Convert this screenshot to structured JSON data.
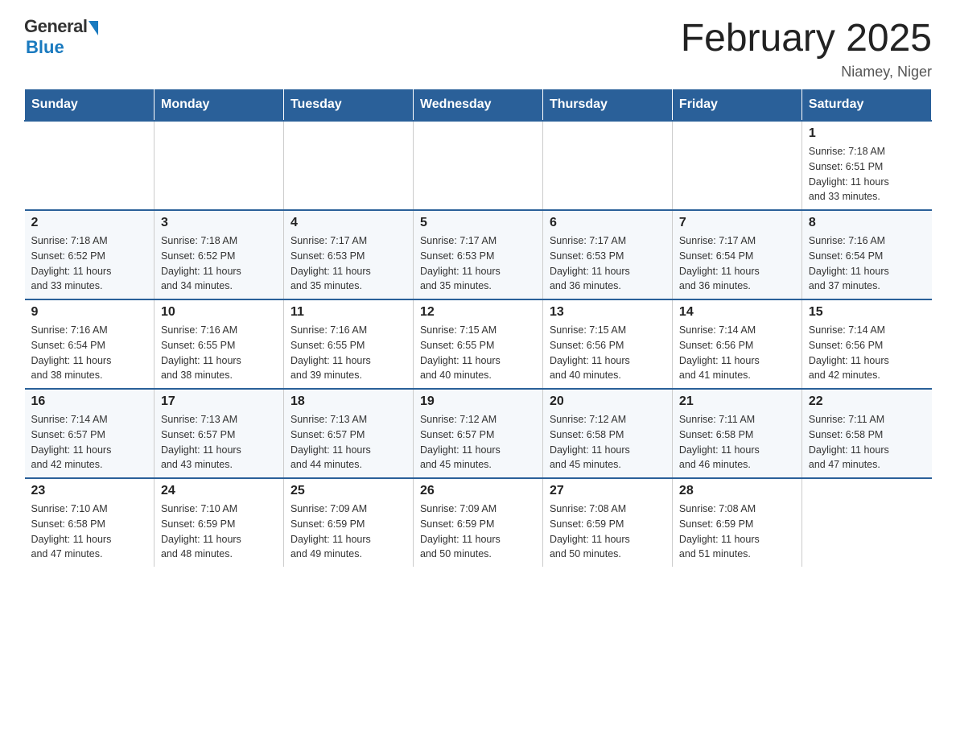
{
  "header": {
    "logo_general": "General",
    "logo_blue": "Blue",
    "title": "February 2025",
    "location": "Niamey, Niger"
  },
  "days_of_week": [
    "Sunday",
    "Monday",
    "Tuesday",
    "Wednesday",
    "Thursday",
    "Friday",
    "Saturday"
  ],
  "weeks": [
    [
      {
        "day": "",
        "info": ""
      },
      {
        "day": "",
        "info": ""
      },
      {
        "day": "",
        "info": ""
      },
      {
        "day": "",
        "info": ""
      },
      {
        "day": "",
        "info": ""
      },
      {
        "day": "",
        "info": ""
      },
      {
        "day": "1",
        "info": "Sunrise: 7:18 AM\nSunset: 6:51 PM\nDaylight: 11 hours\nand 33 minutes."
      }
    ],
    [
      {
        "day": "2",
        "info": "Sunrise: 7:18 AM\nSunset: 6:52 PM\nDaylight: 11 hours\nand 33 minutes."
      },
      {
        "day": "3",
        "info": "Sunrise: 7:18 AM\nSunset: 6:52 PM\nDaylight: 11 hours\nand 34 minutes."
      },
      {
        "day": "4",
        "info": "Sunrise: 7:17 AM\nSunset: 6:53 PM\nDaylight: 11 hours\nand 35 minutes."
      },
      {
        "day": "5",
        "info": "Sunrise: 7:17 AM\nSunset: 6:53 PM\nDaylight: 11 hours\nand 35 minutes."
      },
      {
        "day": "6",
        "info": "Sunrise: 7:17 AM\nSunset: 6:53 PM\nDaylight: 11 hours\nand 36 minutes."
      },
      {
        "day": "7",
        "info": "Sunrise: 7:17 AM\nSunset: 6:54 PM\nDaylight: 11 hours\nand 36 minutes."
      },
      {
        "day": "8",
        "info": "Sunrise: 7:16 AM\nSunset: 6:54 PM\nDaylight: 11 hours\nand 37 minutes."
      }
    ],
    [
      {
        "day": "9",
        "info": "Sunrise: 7:16 AM\nSunset: 6:54 PM\nDaylight: 11 hours\nand 38 minutes."
      },
      {
        "day": "10",
        "info": "Sunrise: 7:16 AM\nSunset: 6:55 PM\nDaylight: 11 hours\nand 38 minutes."
      },
      {
        "day": "11",
        "info": "Sunrise: 7:16 AM\nSunset: 6:55 PM\nDaylight: 11 hours\nand 39 minutes."
      },
      {
        "day": "12",
        "info": "Sunrise: 7:15 AM\nSunset: 6:55 PM\nDaylight: 11 hours\nand 40 minutes."
      },
      {
        "day": "13",
        "info": "Sunrise: 7:15 AM\nSunset: 6:56 PM\nDaylight: 11 hours\nand 40 minutes."
      },
      {
        "day": "14",
        "info": "Sunrise: 7:14 AM\nSunset: 6:56 PM\nDaylight: 11 hours\nand 41 minutes."
      },
      {
        "day": "15",
        "info": "Sunrise: 7:14 AM\nSunset: 6:56 PM\nDaylight: 11 hours\nand 42 minutes."
      }
    ],
    [
      {
        "day": "16",
        "info": "Sunrise: 7:14 AM\nSunset: 6:57 PM\nDaylight: 11 hours\nand 42 minutes."
      },
      {
        "day": "17",
        "info": "Sunrise: 7:13 AM\nSunset: 6:57 PM\nDaylight: 11 hours\nand 43 minutes."
      },
      {
        "day": "18",
        "info": "Sunrise: 7:13 AM\nSunset: 6:57 PM\nDaylight: 11 hours\nand 44 minutes."
      },
      {
        "day": "19",
        "info": "Sunrise: 7:12 AM\nSunset: 6:57 PM\nDaylight: 11 hours\nand 45 minutes."
      },
      {
        "day": "20",
        "info": "Sunrise: 7:12 AM\nSunset: 6:58 PM\nDaylight: 11 hours\nand 45 minutes."
      },
      {
        "day": "21",
        "info": "Sunrise: 7:11 AM\nSunset: 6:58 PM\nDaylight: 11 hours\nand 46 minutes."
      },
      {
        "day": "22",
        "info": "Sunrise: 7:11 AM\nSunset: 6:58 PM\nDaylight: 11 hours\nand 47 minutes."
      }
    ],
    [
      {
        "day": "23",
        "info": "Sunrise: 7:10 AM\nSunset: 6:58 PM\nDaylight: 11 hours\nand 47 minutes."
      },
      {
        "day": "24",
        "info": "Sunrise: 7:10 AM\nSunset: 6:59 PM\nDaylight: 11 hours\nand 48 minutes."
      },
      {
        "day": "25",
        "info": "Sunrise: 7:09 AM\nSunset: 6:59 PM\nDaylight: 11 hours\nand 49 minutes."
      },
      {
        "day": "26",
        "info": "Sunrise: 7:09 AM\nSunset: 6:59 PM\nDaylight: 11 hours\nand 50 minutes."
      },
      {
        "day": "27",
        "info": "Sunrise: 7:08 AM\nSunset: 6:59 PM\nDaylight: 11 hours\nand 50 minutes."
      },
      {
        "day": "28",
        "info": "Sunrise: 7:08 AM\nSunset: 6:59 PM\nDaylight: 11 hours\nand 51 minutes."
      },
      {
        "day": "",
        "info": ""
      }
    ]
  ]
}
